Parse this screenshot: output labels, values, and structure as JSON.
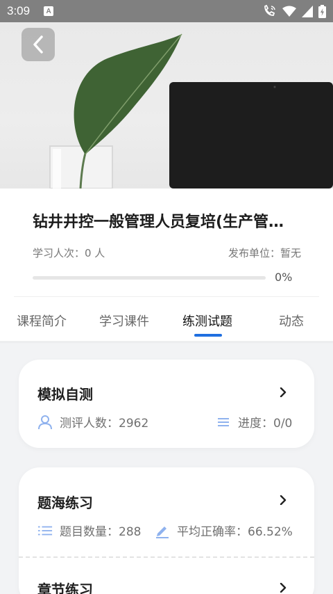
{
  "status_bar": {
    "time": "3:09",
    "notification_badge": "A"
  },
  "hero": {
    "back_icon": "chevron-left-icon"
  },
  "course": {
    "title": "钻井井控一般管理人员复培(生产管…",
    "learners": "学习人次：0 人",
    "publisher": "发布单位：暂无",
    "progress_percent": 0,
    "progress_text": "0%"
  },
  "tabs": [
    {
      "label": "课程简介",
      "active": false
    },
    {
      "label": "学习课件",
      "active": false
    },
    {
      "label": "练测试题",
      "active": true
    },
    {
      "label": "动态",
      "active": false
    }
  ],
  "cards": {
    "mock_test": {
      "title": "模拟自测",
      "examinees": "测评人数：2962",
      "progress": "进度：0/0"
    },
    "question_bank": {
      "title": "题海练习",
      "question_count": "题目数量：288",
      "accuracy": "平均正确率：66.52%"
    },
    "chapter_practice": {
      "title": "章节练习"
    }
  },
  "colors": {
    "accent": "#1f6fe0",
    "icon_light": "#8fb2ee",
    "statusbar": "#808080"
  }
}
